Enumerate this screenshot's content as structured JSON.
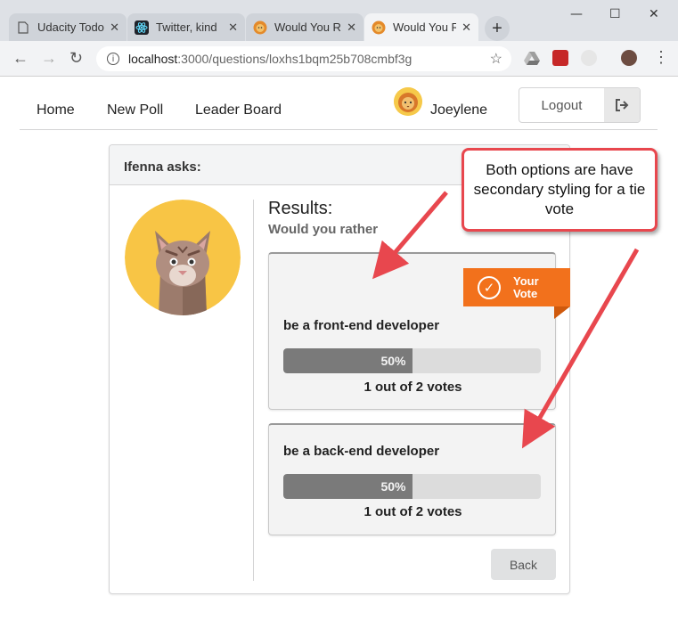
{
  "browser": {
    "tabs": [
      {
        "title": "Udacity Todo",
        "icon": "document-icon",
        "active": false
      },
      {
        "title": "Twitter, kind",
        "icon": "react-icon",
        "active": false
      },
      {
        "title": "Would You R",
        "icon": "lion-icon",
        "active": false
      },
      {
        "title": "Would You R",
        "icon": "lion-icon",
        "active": true
      }
    ],
    "new_tab_label": "+",
    "url_host": "localhost",
    "url_path": ":3000/questions/loxhs1bqm25b708cmbf3g"
  },
  "nav": {
    "home": "Home",
    "new_poll": "New Poll",
    "leader_board": "Leader Board",
    "username": "Joeylene",
    "logout": "Logout"
  },
  "poll": {
    "asker": "Ifenna asks:",
    "results_title": "Results:",
    "subtitle": "Would you rather",
    "badge_line1": "Your",
    "badge_line2": "Vote",
    "options": [
      {
        "text": "be a front-end developer",
        "percent_label": "50%",
        "percent": 50,
        "votes": "1 out of 2 votes",
        "is_user_vote": true
      },
      {
        "text": "be a back-end developer",
        "percent_label": "50%",
        "percent": 50,
        "votes": "1 out of 2 votes",
        "is_user_vote": false
      }
    ],
    "back": "Back"
  },
  "annotation": {
    "text": "Both options are have secondary styling for a tie vote",
    "color": "#e8474e"
  },
  "colors": {
    "ribbon": "#f2711c",
    "bar_fill": "#7a7a7a",
    "bar_track": "#dcdcdc"
  }
}
